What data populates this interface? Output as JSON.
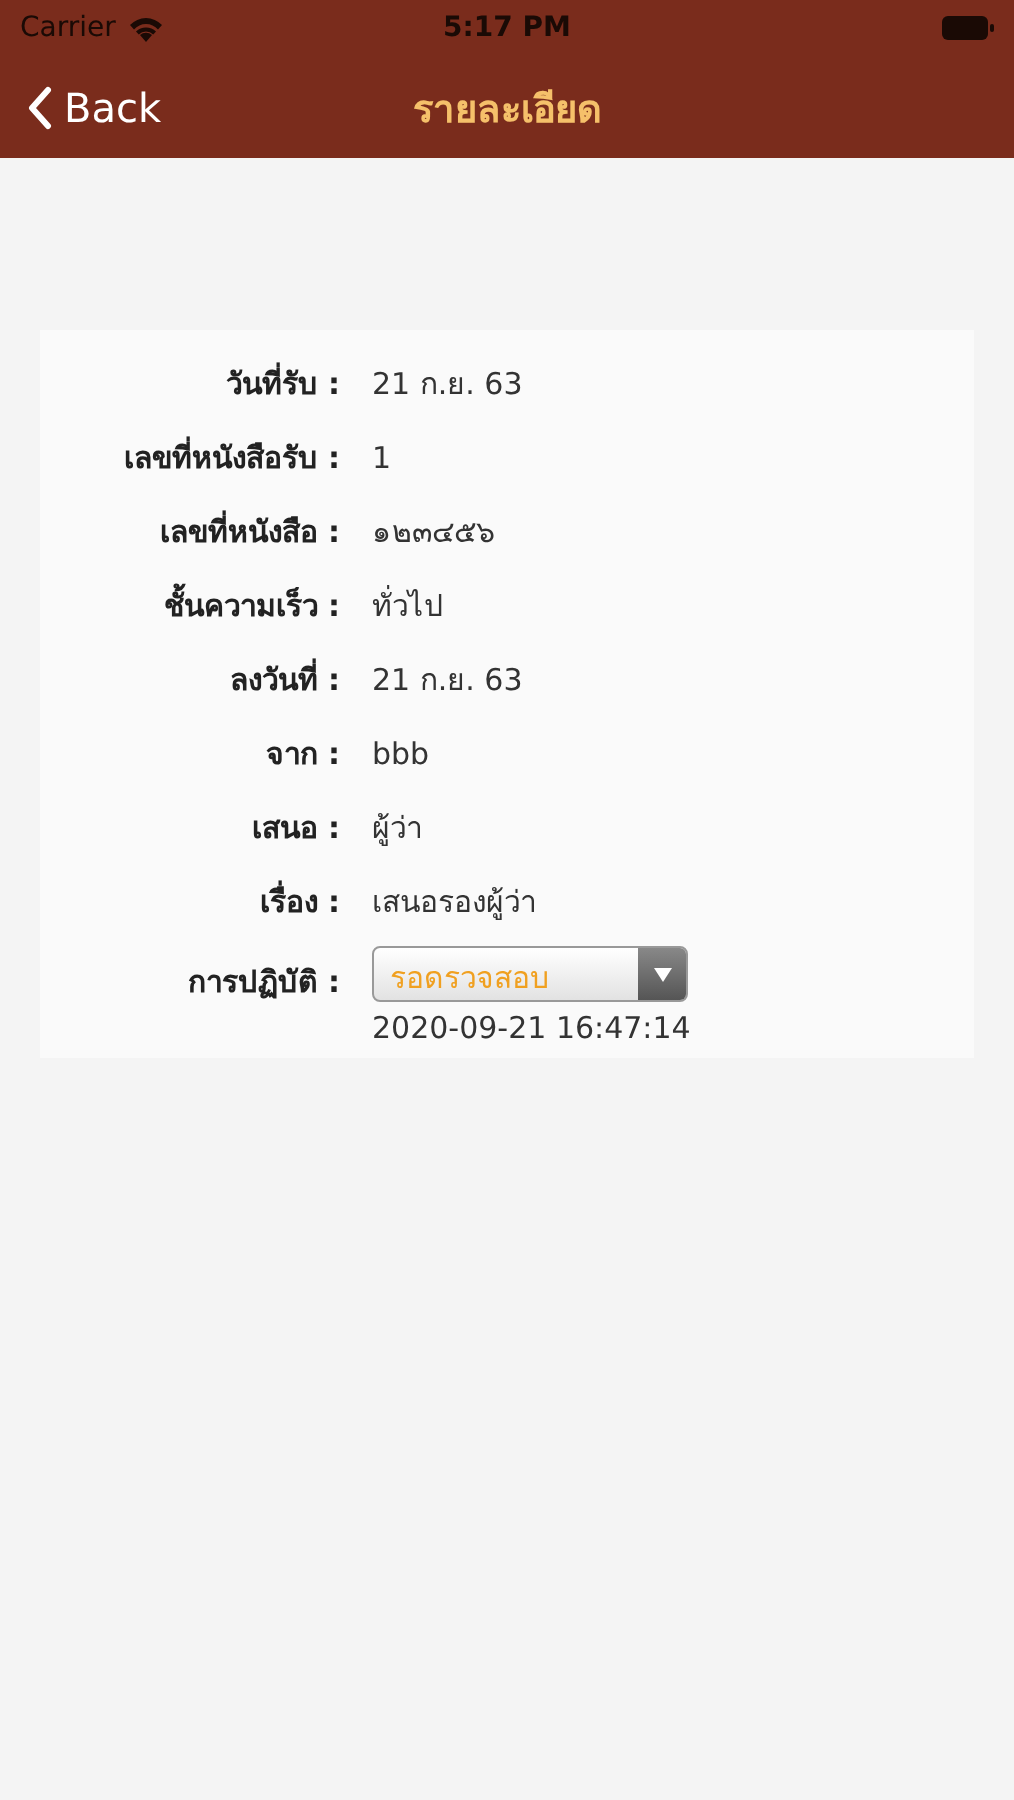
{
  "status_bar": {
    "carrier": "Carrier",
    "time": "5:17 PM"
  },
  "nav": {
    "back": "Back",
    "title": "รายละเอียด"
  },
  "fields": [
    {
      "label": "วันที่รับ :",
      "value": "21 ก.ย. 63"
    },
    {
      "label": "เลขที่หนังสือรับ :",
      "value": "1"
    },
    {
      "label": "เลขที่หนังสือ :",
      "value": "๑๒๓๔๕๖"
    },
    {
      "label": "ชั้นความเร็ว :",
      "value": "ทั่วไป"
    },
    {
      "label": "ลงวันที่ :",
      "value": "21 ก.ย. 63"
    },
    {
      "label": "จาก :",
      "value": "bbb"
    },
    {
      "label": "เสนอ :",
      "value": "ผู้ว่า"
    },
    {
      "label": "เรื่อง :",
      "value": "เสนอรองผู้ว่า"
    }
  ],
  "action": {
    "label": "การปฏิบัติ :",
    "value": "รอดรวจสอบ",
    "timestamp": "2020-09-21 16:47:14"
  }
}
